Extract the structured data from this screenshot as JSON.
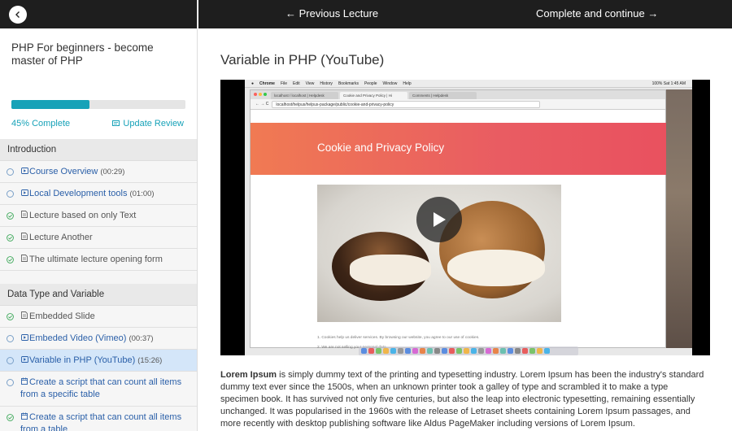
{
  "nav": {
    "prev_label": "← Previous Lecture",
    "next_label": "Complete and continue →"
  },
  "course": {
    "title": "PHP For beginners - become master of PHP",
    "progress_percent": 45,
    "progress_label": "45% Complete",
    "update_review_label": "Update Review"
  },
  "sections": [
    {
      "title": "Introduction",
      "lessons": [
        {
          "label": "Course Overview",
          "duration": "(00:29)",
          "type": "video",
          "done": false
        },
        {
          "label": "Local Development tools",
          "duration": "(01:00)",
          "type": "video",
          "done": false
        },
        {
          "label": "Lecture based on only Text",
          "duration": "",
          "type": "text",
          "done": true
        },
        {
          "label": "Lecture Another",
          "duration": "",
          "type": "text",
          "done": true
        },
        {
          "label": "The ultimate lecture opening form",
          "duration": "",
          "type": "text",
          "done": true
        }
      ]
    },
    {
      "title": "Data Type and Variable",
      "lessons": [
        {
          "label": "Embedded Slide",
          "duration": "",
          "type": "text",
          "done": true
        },
        {
          "label": "Embeded Video (Vimeo)",
          "duration": "(00:37)",
          "type": "video",
          "done": false
        },
        {
          "label": "Variable in PHP (YouTube)",
          "duration": "(15:26)",
          "type": "video",
          "done": false,
          "active": true
        },
        {
          "label": "Create a script that can count all items from a specific table",
          "duration": "",
          "type": "quiz",
          "done": false
        },
        {
          "label": "Create a script that can count all items from a table",
          "duration": "",
          "type": "quiz",
          "done": true
        }
      ]
    }
  ],
  "lecture": {
    "title": "Variable in PHP (YouTube)",
    "description_lead": "Lorem Ipsum",
    "description_rest": " is simply dummy text of the printing and typesetting industry. Lorem Ipsum has been the industry's standard dummy text ever since the 1500s, when an unknown printer took a galley of type and scrambled it to make a type specimen book. It has survived not only five centuries, but also the leap into electronic typesetting, remaining essentially unchanged. It was popularised in the 1960s with the release of Letraset sheets containing Lorem Ipsum passages, and more recently with desktop publishing software like Aldus PageMaker including versions of Lorem Ipsum."
  },
  "video": {
    "mac_menu": [
      "Chrome",
      "File",
      "Edit",
      "View",
      "History",
      "Bookmarks",
      "People",
      "Window",
      "Help"
    ],
    "mac_status": "100% Sat 1:45 AM",
    "tabs": [
      "localhost / localhost | Helpdesk",
      "Cookie and Privacy Policy | Hi",
      "Comments | Helpdesk"
    ],
    "url": "localhost/helpus/helpus-package/public/cookie-and-privacy-policy",
    "hero_title": "Cookie and Privacy Policy",
    "line1": "1. Cookies help us deliver services. By browsing our website, you agree to our use of cookies.",
    "line2": "2. We are not selling your personal data"
  },
  "colors": {
    "accent": "#17a2b8",
    "link": "#2a5fa8",
    "done": "#3aa757",
    "active_row": "#d4e6f9",
    "topbar": "#1e1e1e"
  }
}
